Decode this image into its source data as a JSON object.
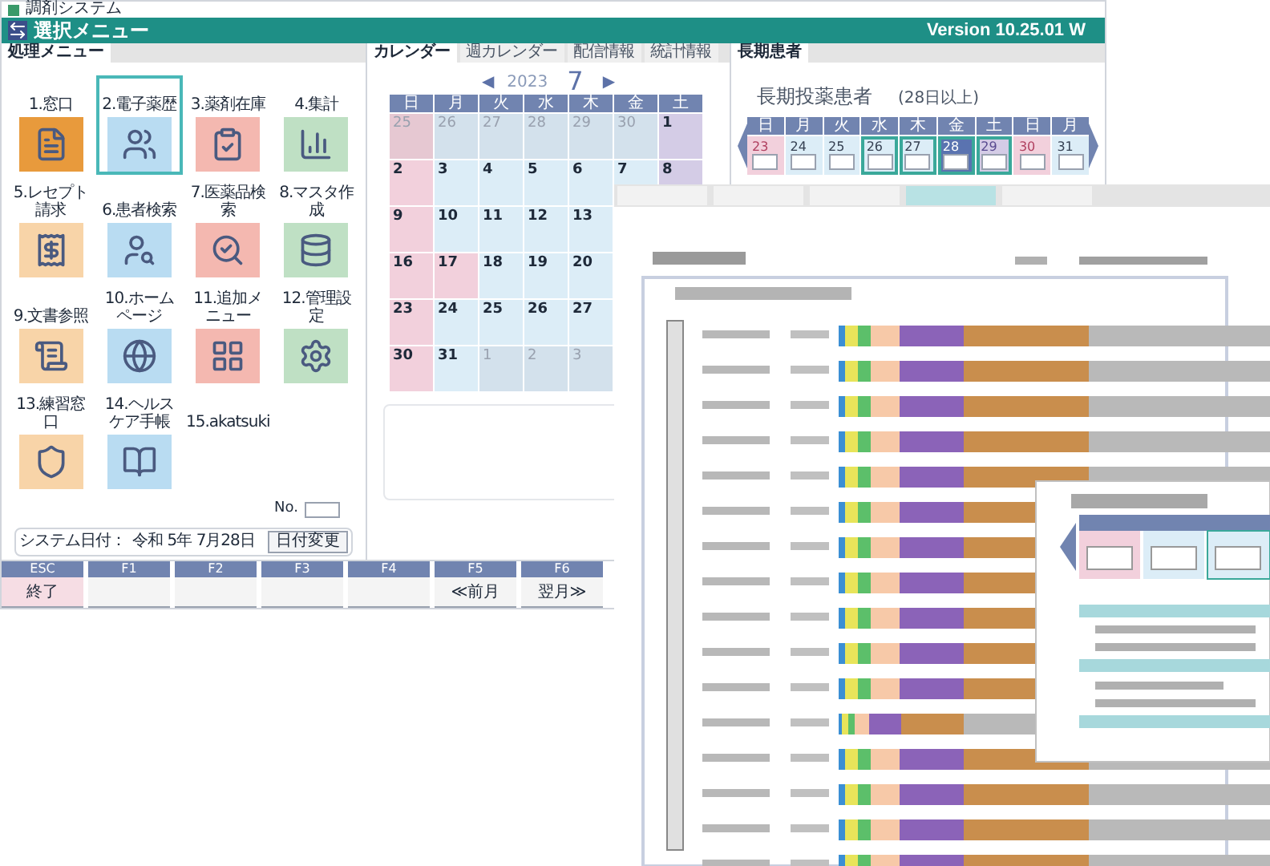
{
  "window": {
    "title": "調剤システム"
  },
  "header": {
    "title": "選択メニュー",
    "version": "Version 10.25.01 W"
  },
  "menu_panel": {
    "tab": "処理メニュー",
    "items": [
      {
        "label": "1.窓口",
        "selected": false
      },
      {
        "label": "2.電子薬歴",
        "selected": true
      },
      {
        "label": "3.薬剤在庫",
        "selected": false
      },
      {
        "label": "4.集計",
        "selected": false
      },
      {
        "label": "5.レセプト請求",
        "selected": false
      },
      {
        "label": "6.患者検索",
        "selected": false
      },
      {
        "label": "7.医薬品検索",
        "selected": false
      },
      {
        "label": "8.マスタ作成",
        "selected": false
      },
      {
        "label": "9.文書参照",
        "selected": false
      },
      {
        "label": "10.ホームページ",
        "selected": false
      },
      {
        "label": "11.追加メニュー",
        "selected": false
      },
      {
        "label": "12.管理設定",
        "selected": false
      },
      {
        "label": "13.練習窓口",
        "selected": false
      },
      {
        "label": "14.ヘルスケア手帳",
        "selected": false
      },
      {
        "label": "15.akatsuki",
        "selected": false
      }
    ],
    "number_label": "No.",
    "system_date_label": "システム日付：",
    "system_date": "令和 5年 7月28日",
    "date_button": "日付変更"
  },
  "calendar_panel": {
    "tabs": [
      {
        "label": "カレンダー",
        "selected": true
      },
      {
        "label": "週カレンダー",
        "selected": false
      },
      {
        "label": "配信情報",
        "selected": false
      },
      {
        "label": "統計情報",
        "selected": false
      }
    ],
    "prev": "◀",
    "year": "2023",
    "month": "7",
    "next": "▶",
    "weekdays": [
      "日",
      "月",
      "火",
      "水",
      "木",
      "金",
      "土"
    ],
    "weeks": [
      [
        {
          "day": "25",
          "kind": "other_sun"
        },
        {
          "day": "26",
          "kind": "other"
        },
        {
          "day": "27",
          "kind": "other"
        },
        {
          "day": "28",
          "kind": "other"
        },
        {
          "day": "29",
          "kind": "other"
        },
        {
          "day": "30",
          "kind": "other"
        },
        {
          "day": "1",
          "kind": "sat"
        }
      ],
      [
        {
          "day": "2",
          "kind": "sun"
        },
        {
          "day": "3",
          "kind": "weekday"
        },
        {
          "day": "4",
          "kind": "weekday"
        },
        {
          "day": "5",
          "kind": "weekday"
        },
        {
          "day": "6",
          "kind": "weekday"
        },
        {
          "day": "7",
          "kind": "weekday"
        },
        {
          "day": "8",
          "kind": "sat"
        }
      ],
      [
        {
          "day": "9",
          "kind": "sun"
        },
        {
          "day": "10",
          "kind": "weekday"
        },
        {
          "day": "11",
          "kind": "weekday"
        },
        {
          "day": "12",
          "kind": "weekday"
        },
        {
          "day": "13",
          "kind": "weekday"
        }
      ],
      [
        {
          "day": "16",
          "kind": "sun"
        },
        {
          "day": "17",
          "kind": "holiday"
        },
        {
          "day": "18",
          "kind": "weekday"
        },
        {
          "day": "19",
          "kind": "weekday"
        },
        {
          "day": "20",
          "kind": "weekday"
        }
      ],
      [
        {
          "day": "23",
          "kind": "sun"
        },
        {
          "day": "24",
          "kind": "weekday"
        },
        {
          "day": "25",
          "kind": "weekday"
        },
        {
          "day": "26",
          "kind": "weekday"
        },
        {
          "day": "27",
          "kind": "weekday"
        }
      ],
      [
        {
          "day": "30",
          "kind": "sun"
        },
        {
          "day": "31",
          "kind": "weekday"
        },
        {
          "day": "1",
          "kind": "other"
        },
        {
          "day": "2",
          "kind": "other"
        },
        {
          "day": "3",
          "kind": "other"
        }
      ]
    ]
  },
  "long_term_panel": {
    "tab": "長期患者",
    "title": "長期投薬患者",
    "note": "(28日以上)",
    "days": [
      {
        "weekday": "日",
        "day": "23",
        "kind": "sun",
        "marked": false,
        "selected": false
      },
      {
        "weekday": "月",
        "day": "24",
        "kind": "weekday",
        "marked": false,
        "selected": false
      },
      {
        "weekday": "火",
        "day": "25",
        "kind": "weekday",
        "marked": false,
        "selected": false
      },
      {
        "weekday": "水",
        "day": "26",
        "kind": "weekday",
        "marked": true,
        "selected": false
      },
      {
        "weekday": "木",
        "day": "27",
        "kind": "weekday",
        "marked": true,
        "selected": false
      },
      {
        "weekday": "金",
        "day": "28",
        "kind": "weekday",
        "marked": true,
        "selected": true
      },
      {
        "weekday": "土",
        "day": "29",
        "kind": "sat",
        "marked": true,
        "selected": false
      },
      {
        "weekday": "日",
        "day": "30",
        "kind": "sun",
        "marked": false,
        "selected": false
      },
      {
        "weekday": "月",
        "day": "31",
        "kind": "weekday",
        "marked": false,
        "selected": false
      }
    ]
  },
  "function_keys": [
    {
      "key": "ESC",
      "label": "終了",
      "kind": "exit"
    },
    {
      "key": "F1",
      "kind": "normal"
    },
    {
      "key": "F2",
      "kind": "normal"
    },
    {
      "key": "F3",
      "kind": "normal"
    },
    {
      "key": "F4",
      "kind": "normal"
    },
    {
      "key": "F5",
      "label": "≪前月",
      "kind": "normal"
    },
    {
      "key": "F6",
      "label": "翌月≫",
      "kind": "normal"
    }
  ]
}
